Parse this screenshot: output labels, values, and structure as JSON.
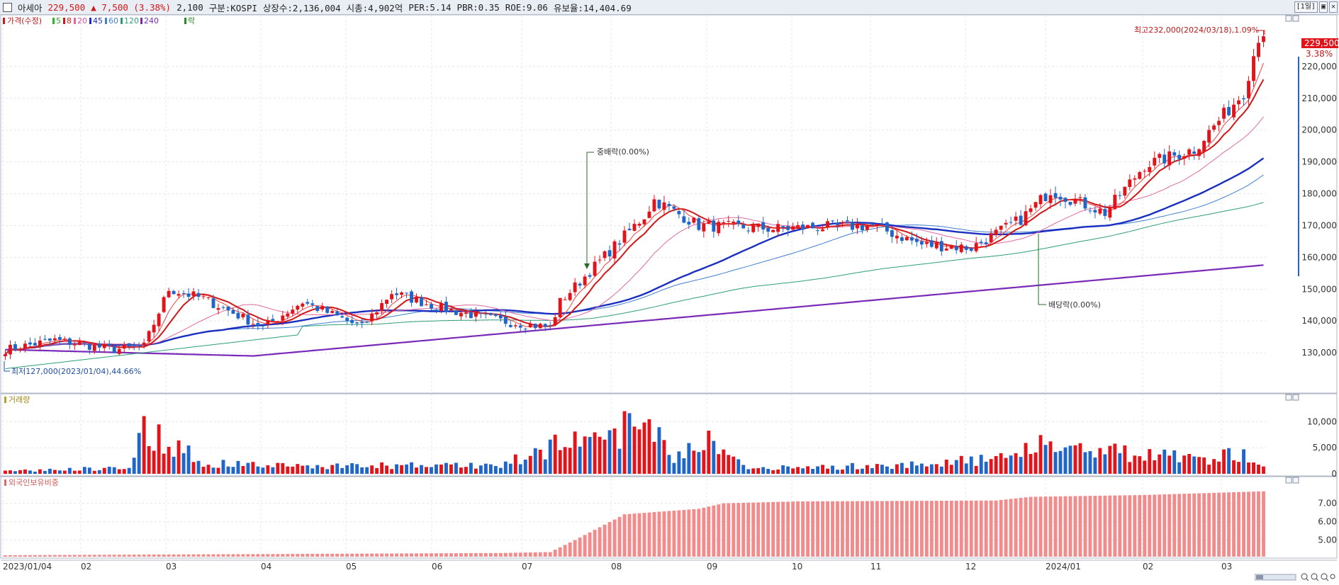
{
  "header": {
    "name": "아세아",
    "price": "229,500",
    "change": "▲ 7,500 (3.38%)",
    "volume": "2,100",
    "market": "구분:KOSPI",
    "shares": "상장수:2,136,004",
    "mcap": "시총:4,902억",
    "per": "PER:5.14",
    "pbr": "PBR:0.35",
    "roe": "ROE:9.06",
    "float": "유보율:14,404.69",
    "period": "1일"
  },
  "legend": {
    "price": "가격(수정)",
    "ma5": "5",
    "ma8": "8",
    "ma20": "20",
    "ma45": "45",
    "ma60": "60",
    "ma120": "120",
    "ma240": "240",
    "drop": "락",
    "volume": "거래량",
    "foreign": "외국인보유비중"
  },
  "colors": {
    "up": "#e0141a",
    "down": "#1f66c8",
    "ma5": "#f04040",
    "ma8": "#d01818",
    "ma20": "#e06aa0",
    "ma45": "#1a2fc0",
    "ma60": "#3f7fd0",
    "ma120": "#2e9e7a",
    "ma240": "#7a2ab8",
    "foreign_bar": "#f28c8c",
    "accent": "#1f66c8"
  },
  "annotations": {
    "high": "최고232,000(2024/03/18),1.09%",
    "low": "최저127,000(2023/01/04),44.66%",
    "bonus": "중배락(0.00%)",
    "dividend": "배당락(0.00%)",
    "last_price": "229,500",
    "last_pct": "3.38%"
  },
  "chart_data": [
    {
      "type": "candlestick",
      "title": "가격(수정)",
      "y_ticks": [
        "220,000",
        "210,000",
        "200,000",
        "190,000",
        "180,000",
        "170,000",
        "160,000",
        "150,000",
        "140,000",
        "130,000"
      ],
      "ylim": [
        118000,
        236000
      ],
      "x_ticks": [
        "2023/01/04",
        "02",
        "03",
        "04",
        "05",
        "06",
        "07",
        "08",
        "09",
        "10",
        "11",
        "12",
        "2024/01",
        "02",
        "03"
      ],
      "anchors": [
        [
          0,
          131000
        ],
        [
          10,
          134000
        ],
        [
          22,
          131000
        ],
        [
          28,
          132000
        ],
        [
          33,
          150000
        ],
        [
          40,
          147000
        ],
        [
          52,
          138000
        ],
        [
          60,
          146000
        ],
        [
          72,
          138000
        ],
        [
          78,
          149000
        ],
        [
          88,
          144000
        ],
        [
          100,
          140000
        ],
        [
          110,
          138000
        ],
        [
          112,
          146000
        ],
        [
          122,
          162000
        ],
        [
          129,
          173000
        ],
        [
          131,
          178000
        ],
        [
          140,
          170000
        ],
        [
          155,
          169000
        ],
        [
          175,
          170000
        ],
        [
          185,
          164000
        ],
        [
          195,
          163000
        ],
        [
          205,
          172000
        ],
        [
          211,
          181000
        ],
        [
          222,
          174000
        ],
        [
          230,
          189000
        ],
        [
          240,
          194000
        ],
        [
          245,
          203000
        ],
        [
          250,
          212000
        ],
        [
          253,
          229500
        ]
      ],
      "moving_averages": [
        "5",
        "8",
        "20",
        "45",
        "60",
        "120",
        "240"
      ],
      "high": 232000,
      "low": 127000
    },
    {
      "type": "bar",
      "title": "거래량",
      "y_ticks": [
        "10,000",
        "5,000",
        "0"
      ],
      "ylim": [
        0,
        14000
      ],
      "anchors": [
        [
          0,
          600
        ],
        [
          25,
          1500
        ],
        [
          27,
          10200
        ],
        [
          32,
          8200
        ],
        [
          40,
          2500
        ],
        [
          60,
          1800
        ],
        [
          100,
          2000
        ],
        [
          108,
          5000
        ],
        [
          112,
          8800
        ],
        [
          118,
          6000
        ],
        [
          123,
          10000
        ],
        [
          130,
          13400
        ],
        [
          135,
          3500
        ],
        [
          140,
          8800
        ],
        [
          150,
          1200
        ],
        [
          180,
          2000
        ],
        [
          205,
          3800
        ],
        [
          207,
          8000
        ],
        [
          215,
          6500
        ],
        [
          230,
          4200
        ],
        [
          240,
          3500
        ],
        [
          250,
          4500
        ],
        [
          254,
          2100
        ]
      ]
    },
    {
      "type": "bar",
      "title": "외국인보유비중",
      "y_ticks": [
        "7.00",
        "6.00",
        "5.00"
      ],
      "ylim": [
        4.1,
        8.1
      ],
      "anchors": [
        [
          0,
          4.18
        ],
        [
          100,
          4.3
        ],
        [
          110,
          4.35
        ],
        [
          115,
          5.0
        ],
        [
          125,
          6.4
        ],
        [
          140,
          6.7
        ],
        [
          145,
          7.0
        ],
        [
          160,
          7.1
        ],
        [
          200,
          7.15
        ],
        [
          207,
          7.35
        ],
        [
          230,
          7.45
        ],
        [
          254,
          7.65
        ]
      ]
    }
  ]
}
